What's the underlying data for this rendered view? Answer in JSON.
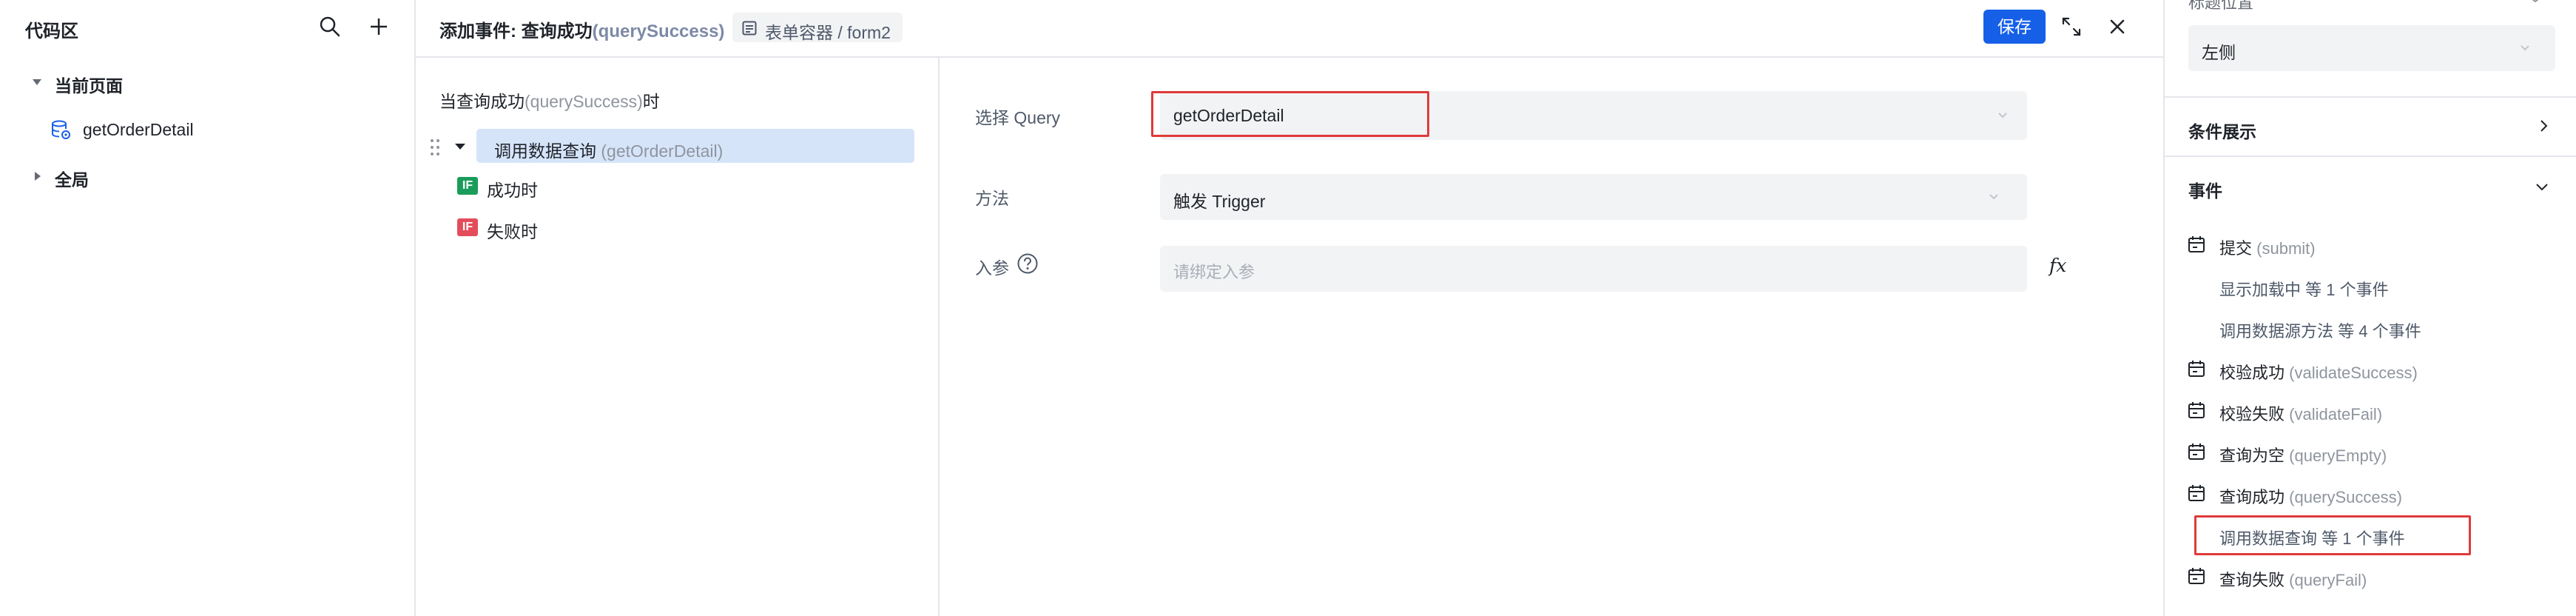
{
  "code_area": {
    "title": "代码区",
    "tree": {
      "current_page": "当前页面",
      "query_item": "getOrderDetail",
      "global": "全局"
    }
  },
  "header": {
    "title_prefix": "添加事件: 查询成功",
    "title_event": "(querySuccess)",
    "breadcrumb": "表单容器 / form2",
    "save_label": "保存"
  },
  "event_tree": {
    "heading_prefix": "当查询成功",
    "heading_event": "(querySuccess)",
    "heading_suffix": "时",
    "action_label": "调用数据查询",
    "action_detail": "(getOrderDetail)",
    "success_badge": "IF",
    "success_label": "成功时",
    "fail_badge": "IF",
    "fail_label": "失败时"
  },
  "form": {
    "query_label": "选择 Query",
    "query_value": "getOrderDetail",
    "method_label": "方法",
    "method_value": "触发 Trigger",
    "params_label": "入参",
    "params_placeholder": "请绑定入参",
    "fx_label": "fx"
  },
  "properties": {
    "cut_label": "标题位置",
    "title_position_value": "左侧",
    "conditional_display": "条件展示",
    "events_section": "事件",
    "events": [
      {
        "name": "提交",
        "code": "(submit)"
      },
      {
        "sub": "显示加载中 等 1 个事件"
      },
      {
        "sub": "调用数据源方法 等 4 个事件"
      },
      {
        "name": "校验成功",
        "code": "(validateSuccess)"
      },
      {
        "name": "校验失败",
        "code": "(validateFail)"
      },
      {
        "name": "查询为空",
        "code": "(queryEmpty)"
      },
      {
        "name": "查询成功",
        "code": "(querySuccess)"
      },
      {
        "sub": "调用数据查询 等 1 个事件"
      },
      {
        "name": "查询失败",
        "code": "(queryFail)"
      }
    ]
  },
  "colors": {
    "accent": "#1660e8",
    "highlight": "#d6e4fa",
    "if_success": "#1a9c5b",
    "if_fail": "#e34d59",
    "annotation": "#e03a3a"
  }
}
